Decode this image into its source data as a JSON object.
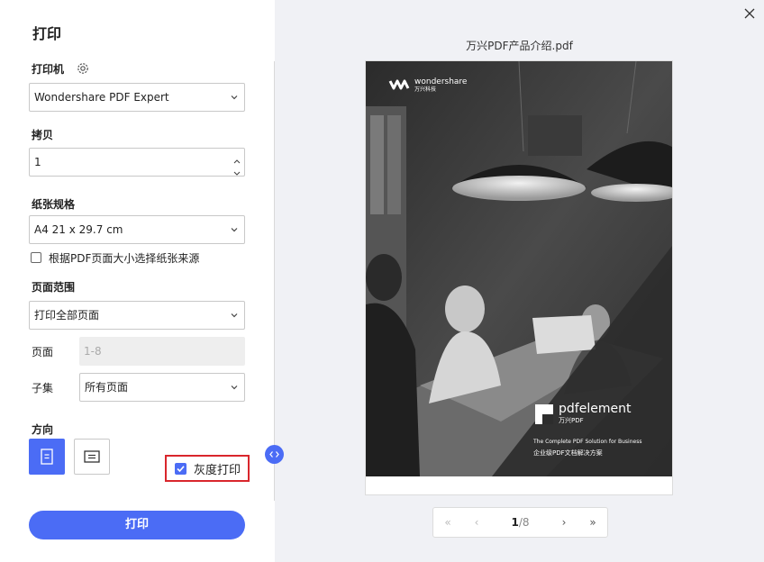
{
  "left_panel": {
    "title": "打印",
    "printer": {
      "label": "打印机",
      "value": "Wondershare PDF Expert"
    },
    "copies": {
      "label": "拷贝",
      "value": "1"
    },
    "paper": {
      "label": "纸张规格",
      "value": "A4 21 x 29.7 cm",
      "auto_source_label": "根据PDF页面大小选择纸张来源",
      "auto_source_checked": false
    },
    "page_range": {
      "label": "页面范围",
      "value": "打印全部页面",
      "pages_label": "页面",
      "pages_placeholder": "1-8",
      "subset_label": "子集",
      "subset_value": "所有页面"
    },
    "orientation": {
      "label": "方向",
      "selected": "portrait"
    },
    "grayscale": {
      "label": "灰度打印",
      "checked": true
    },
    "print_button": "打印"
  },
  "preview": {
    "doc_title": "万兴PDF产品介绍.pdf",
    "cover": {
      "brand": "wondershare",
      "brand_sub": "万兴科技",
      "product": "pdfelement",
      "product_sub": "万兴PDF",
      "tagline_en": "The Complete PDF Solution for Business",
      "tagline_cn": "企业级PDF文档解决方案"
    },
    "pager": {
      "current": "1",
      "total": "/8"
    }
  },
  "colors": {
    "accent": "#4b6cf5",
    "highlight_border": "#d9262c"
  }
}
